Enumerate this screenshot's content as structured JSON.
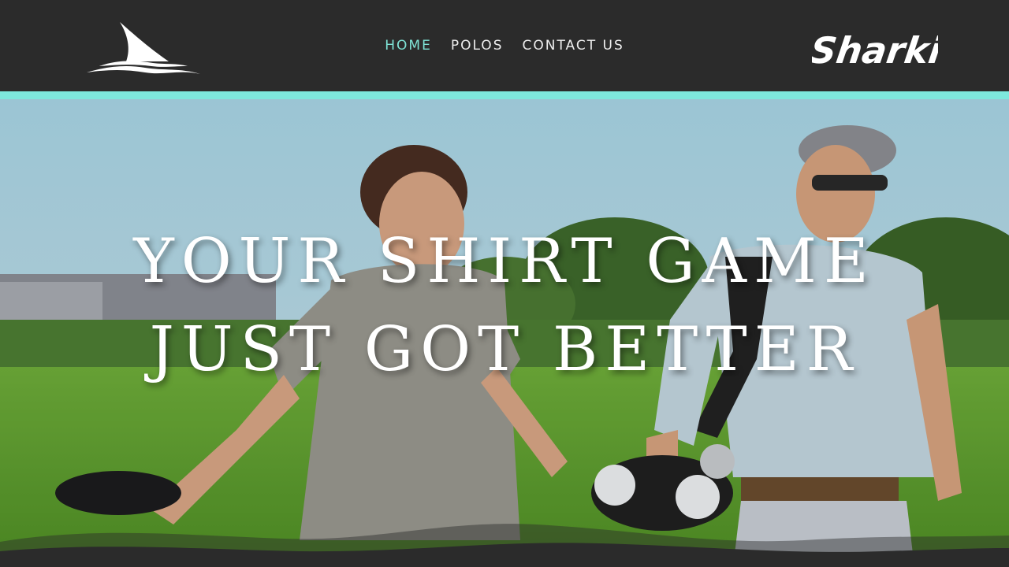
{
  "header": {
    "logo_icon": "shark-fin-wave-icon",
    "brand_name": "Sharkie",
    "nav": [
      {
        "label": "HOME",
        "active": true
      },
      {
        "label": "POLOS",
        "active": false
      },
      {
        "label": "CONTACT US",
        "active": false
      }
    ]
  },
  "hero": {
    "headline_line1": "YOUR SHIRT GAME",
    "headline_line2": "JUST GOT BETTER",
    "background": "golf-course-two-men-walking-with-bags"
  },
  "colors": {
    "header_bg": "#2b2b2b",
    "accent": "#7ee8dd",
    "nav_active": "#7fe3d6",
    "nav_text": "#eeeeee",
    "headline_text": "#ffffff"
  }
}
